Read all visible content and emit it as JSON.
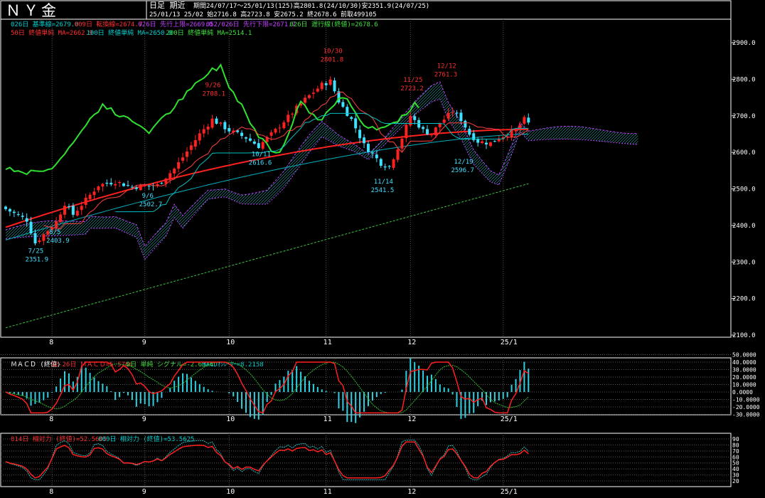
{
  "header": {
    "title": "ＮＹ金",
    "mode": "日足 期近",
    "period_line": "期間24/07/17～25/01/13(125)高2801.8(24/10/30)安2351.9(24/07/25)",
    "ohlc_line": "25/01/13 25/02 始2716.8 高2723.8 安2675.2 終2678.6 前取499105"
  },
  "indicators": {
    "ichimoku": [
      {
        "text": "026日 基準線=2679.0",
        "color": "#00d0d0"
      },
      {
        "text": "009日 転換線=2674.7",
        "color": "#ff3030"
      },
      {
        "text": "026日 先行上限=2669.0",
        "color": "#c040ff"
      },
      {
        "text": "052/026日 先行下限=2671.7",
        "color": "#c040ff"
      },
      {
        "text": "026日 遅行線(終値)=2678.6",
        "color": "#40e040"
      }
    ],
    "moving_averages": [
      {
        "text": "50日 終値単純 MA=2662.9",
        "color": "#ff3030"
      },
      {
        "text": "100日 終値単純 MA=2650.0",
        "color": "#00d0d0"
      },
      {
        "text": "200日 終値単純 MA=2514.1",
        "color": "#40e040"
      }
    ],
    "macd": [
      {
        "text": "ＭＡＣＤ (終値)",
        "color": "#ffffff"
      },
      {
        "text": "12-26日 ＭＡＣＤ=5.5784",
        "color": "#ff3030"
      },
      {
        "text": "9日 単純 シグナル=-2.6374",
        "color": "#40e040"
      },
      {
        "text": "MACDｵｼﾚｰﾀｰ=8.2158",
        "color": "#00d0d0"
      }
    ],
    "rsi": [
      {
        "text": "014日 相対力 (終値)=52.5605",
        "color": "#ff3030"
      },
      {
        "text": "009日 相対力 (終値)=53.5625",
        "color": "#00d0d0"
      }
    ]
  },
  "chart_data": [
    {
      "type": "candlestick",
      "title": "ＮＹ金",
      "x_tick_labels": [
        "8",
        "9",
        "10",
        "11",
        "12",
        "25/1"
      ],
      "ylim": [
        2100,
        2950
      ],
      "y_ticks": [
        2100.0,
        2200.0,
        2300.0,
        2400.0,
        2500.0,
        2600.0,
        2700.0,
        2800.0,
        2900.0
      ],
      "period_high": {
        "value": 2801.8,
        "date": "24/10/30"
      },
      "period_low": {
        "value": 2351.9,
        "date": "24/07/25"
      },
      "last_bar": {
        "date": "25/01/13",
        "open": 2716.8,
        "high": 2723.8,
        "low": 2675.2,
        "close": 2678.6
      },
      "price_annotations": [
        {
          "date": "7/25",
          "value": 2351.9,
          "kind": "low"
        },
        {
          "date": "8/5",
          "value": 2403.9,
          "kind": "low"
        },
        {
          "date": "9/6",
          "value": 2502.7,
          "kind": "low"
        },
        {
          "date": "9/26",
          "value": 2708.1,
          "kind": "high"
        },
        {
          "date": "10/11",
          "value": 2616.6,
          "kind": "low"
        },
        {
          "date": "10/30",
          "value": 2801.8,
          "kind": "high"
        },
        {
          "date": "11/14",
          "value": 2541.5,
          "kind": "low"
        },
        {
          "date": "11/25",
          "value": 2723.2,
          "kind": "high"
        },
        {
          "date": "12/12",
          "value": 2761.3,
          "kind": "high"
        },
        {
          "date": "12/19",
          "value": 2596.7,
          "kind": "low"
        }
      ],
      "ma_latest": {
        "ma50": 2662.9,
        "ma100": 2650.0,
        "ma200": 2514.1
      }
    },
    {
      "type": "line",
      "title": "ＭＡＣＤ (終値)",
      "ylim": [
        -30,
        50
      ],
      "y_ticks": [
        50,
        40,
        30,
        20,
        10,
        0,
        -10,
        -20,
        -30
      ],
      "series": [
        {
          "name": "12-26日 ＭＡＣＤ",
          "latest": 5.5784
        },
        {
          "name": "9日 単純 シグナル",
          "latest": -2.6374
        },
        {
          "name": "MACDｵｼﾚｰﾀｰ",
          "latest": 8.2158
        }
      ]
    },
    {
      "type": "line",
      "title": "相対力",
      "ylim": [
        20,
        90
      ],
      "y_ticks": [
        90,
        80,
        70,
        60,
        50,
        40,
        30,
        20
      ],
      "series": [
        {
          "name": "014日 相対力 (終値)",
          "latest": 52.5605
        },
        {
          "name": "009日 相対力 (終値)",
          "latest": 53.5625
        }
      ]
    }
  ]
}
